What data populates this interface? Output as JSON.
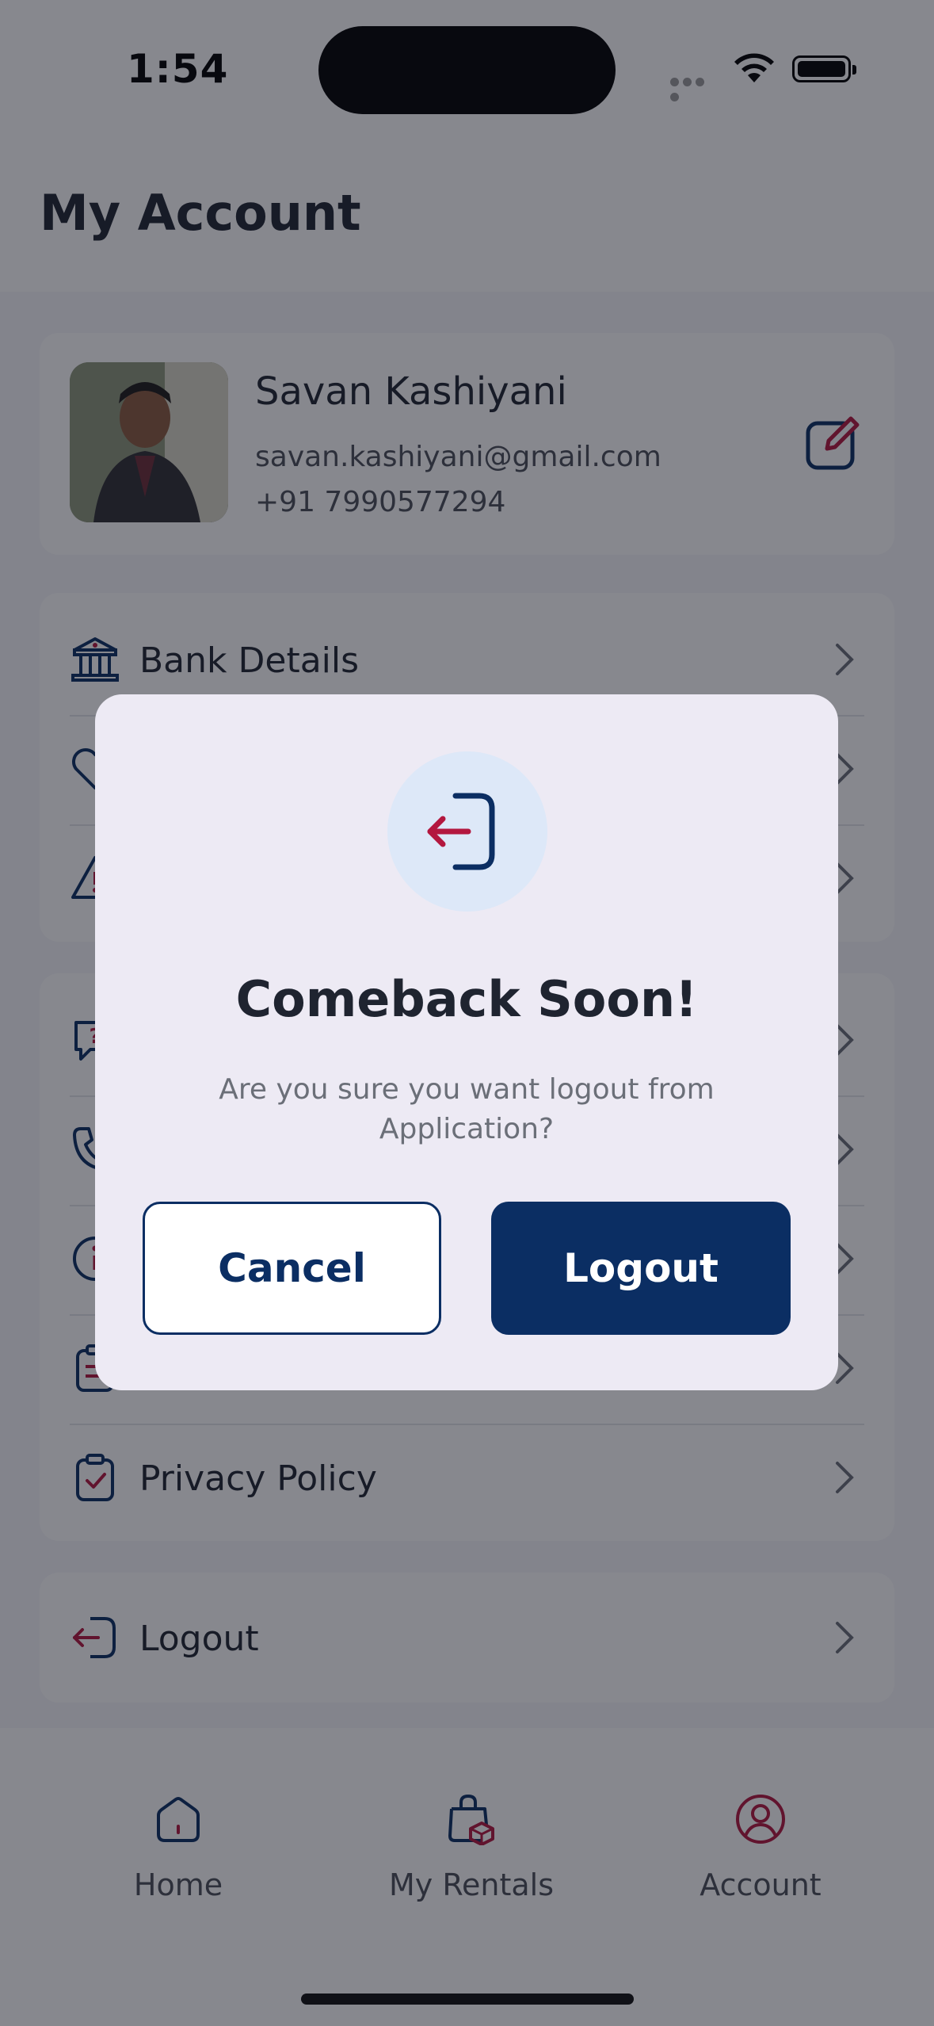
{
  "status_bar": {
    "time": "1:54"
  },
  "header": {
    "title": "My Account"
  },
  "profile": {
    "name": "Savan Kashiyani",
    "email": "savan.kashiyani@gmail.com",
    "phone": "+91 7990577294"
  },
  "menu": {
    "group1": [
      {
        "label": "Bank Details",
        "icon": "bank-icon"
      },
      {
        "label": "",
        "icon": "heart-icon"
      },
      {
        "label": "",
        "icon": "warning-icon"
      }
    ],
    "group2": [
      {
        "label": "",
        "icon": "chat-help-icon"
      },
      {
        "label": "",
        "icon": "phone-icon"
      },
      {
        "label": "",
        "icon": "info-icon"
      },
      {
        "label": "",
        "icon": "clipboard-list-icon"
      },
      {
        "label": "Privacy Policy",
        "icon": "clipboard-check-icon"
      }
    ],
    "logout": {
      "label": "Logout",
      "icon": "logout-icon"
    }
  },
  "bottom_nav": {
    "home": "Home",
    "rentals": "My Rentals",
    "account": "Account"
  },
  "dialog": {
    "title": "Comeback Soon!",
    "message": "Are you sure you want logout from Application?",
    "cancel_label": "Cancel",
    "logout_label": "Logout"
  },
  "colors": {
    "primary": "#0b2e63",
    "accent": "#b3173f",
    "overlay": "rgba(15,18,30,0.5)"
  }
}
